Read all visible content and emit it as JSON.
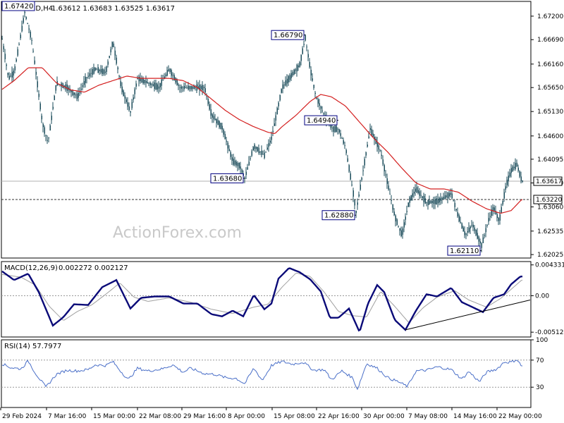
{
  "header": {
    "symbol": "EURAUD,H4",
    "ohlc": "1.63612 1.63683 1.63525 1.63617"
  },
  "watermark": "ActionForex.com",
  "chart_data": [
    {
      "type": "line",
      "name": "price",
      "ylim": [
        1.6195,
        1.6752
      ],
      "yticks": [
        "1.67200",
        "1.66690",
        "1.66160",
        "1.65650",
        "1.65130",
        "1.64600",
        "1.64095",
        "1.63580",
        "1.63060",
        "1.62535",
        "1.62025"
      ],
      "ytick_values": [
        1.672,
        1.6669,
        1.6616,
        1.6565,
        1.6513,
        1.646,
        1.64095,
        1.6358,
        1.6306,
        1.62535,
        1.62025
      ],
      "current_label": "1.63617",
      "current_value": 1.63617,
      "level_label": "1.63220",
      "level_value": 1.6322,
      "xticks": [
        "29 Feb 2024",
        "7 Mar 16:00",
        "15 Mar 00:00",
        "22 Mar 08:00",
        "29 Mar 16:00",
        "8 Apr 00:00",
        "15 Apr 08:00",
        "22 Apr 16:00",
        "30 Apr 00:00",
        "7 May 08:00",
        "14 May 16:00",
        "22 May 00:00"
      ],
      "annotations": [
        {
          "text": "1.67420",
          "value": 1.6742,
          "bar": 30
        },
        {
          "text": "1.66790",
          "value": 1.6679,
          "bar": 433
        },
        {
          "text": "1.63680",
          "value": 1.6368,
          "bar": 347
        },
        {
          "text": "1.64940",
          "value": 1.6494,
          "bar": 480
        },
        {
          "text": "1.62880",
          "value": 1.6288,
          "bar": 505
        },
        {
          "text": "1.62110",
          "value": 1.6211,
          "bar": 683
        }
      ],
      "price_anchors": [
        [
          2,
          1.668
        ],
        [
          12,
          1.6585
        ],
        [
          20,
          1.6598
        ],
        [
          35,
          1.6728
        ],
        [
          45,
          1.6668
        ],
        [
          60,
          1.6488
        ],
        [
          68,
          1.6445
        ],
        [
          80,
          1.6575
        ],
        [
          95,
          1.6565
        ],
        [
          110,
          1.6545
        ],
        [
          122,
          1.6585
        ],
        [
          135,
          1.6605
        ],
        [
          150,
          1.6598
        ],
        [
          160,
          1.6665
        ],
        [
          172,
          1.6565
        ],
        [
          185,
          1.6512
        ],
        [
          195,
          1.6585
        ],
        [
          210,
          1.6575
        ],
        [
          225,
          1.6565
        ],
        [
          240,
          1.6605
        ],
        [
          255,
          1.6565
        ],
        [
          270,
          1.6565
        ],
        [
          290,
          1.6565
        ],
        [
          300,
          1.6505
        ],
        [
          315,
          1.6478
        ],
        [
          330,
          1.6405
        ],
        [
          340,
          1.6395
        ],
        [
          347,
          1.6368
        ],
        [
          360,
          1.6438
        ],
        [
          375,
          1.6418
        ],
        [
          385,
          1.6455
        ],
        [
          400,
          1.6565
        ],
        [
          415,
          1.6595
        ],
        [
          425,
          1.6615
        ],
        [
          433,
          1.6673
        ],
        [
          440,
          1.6605
        ],
        [
          448,
          1.6545
        ],
        [
          460,
          1.6505
        ],
        [
          472,
          1.6475
        ],
        [
          480,
          1.6475
        ],
        [
          490,
          1.6435
        ],
        [
          500,
          1.6345
        ],
        [
          505,
          1.6295
        ],
        [
          515,
          1.6385
        ],
        [
          525,
          1.6475
        ],
        [
          540,
          1.6425
        ],
        [
          550,
          1.6355
        ],
        [
          560,
          1.6285
        ],
        [
          570,
          1.6245
        ],
        [
          580,
          1.6318
        ],
        [
          590,
          1.6345
        ],
        [
          605,
          1.6315
        ],
        [
          620,
          1.6318
        ],
        [
          640,
          1.6335
        ],
        [
          650,
          1.6285
        ],
        [
          660,
          1.6245
        ],
        [
          670,
          1.6268
        ],
        [
          683,
          1.6222
        ],
        [
          693,
          1.6278
        ],
        [
          700,
          1.6305
        ],
        [
          708,
          1.6275
        ],
        [
          718,
          1.6355
        ],
        [
          725,
          1.6385
        ],
        [
          733,
          1.6398
        ],
        [
          740,
          1.6362
        ]
      ],
      "ma_anchors": [
        [
          2,
          1.656
        ],
        [
          20,
          1.658
        ],
        [
          40,
          1.6608
        ],
        [
          60,
          1.6608
        ],
        [
          80,
          1.6575
        ],
        [
          100,
          1.656
        ],
        [
          120,
          1.6555
        ],
        [
          140,
          1.657
        ],
        [
          160,
          1.658
        ],
        [
          180,
          1.659
        ],
        [
          200,
          1.6585
        ],
        [
          220,
          1.6585
        ],
        [
          240,
          1.6585
        ],
        [
          260,
          1.658
        ],
        [
          280,
          1.6565
        ],
        [
          300,
          1.654
        ],
        [
          320,
          1.6515
        ],
        [
          340,
          1.6495
        ],
        [
          360,
          1.648
        ],
        [
          380,
          1.6468
        ],
        [
          390,
          1.6465
        ],
        [
          400,
          1.648
        ],
        [
          420,
          1.6505
        ],
        [
          440,
          1.6535
        ],
        [
          455,
          1.655
        ],
        [
          470,
          1.6545
        ],
        [
          490,
          1.6525
        ],
        [
          510,
          1.649
        ],
        [
          530,
          1.6455
        ],
        [
          550,
          1.6425
        ],
        [
          570,
          1.639
        ],
        [
          590,
          1.6358
        ],
        [
          610,
          1.6345
        ],
        [
          630,
          1.6345
        ],
        [
          650,
          1.6338
        ],
        [
          670,
          1.6318
        ],
        [
          690,
          1.6302
        ],
        [
          710,
          1.6292
        ],
        [
          725,
          1.6298
        ],
        [
          740,
          1.6322
        ]
      ]
    },
    {
      "type": "line",
      "name": "MACD(12,26,9)",
      "header_label": "MACD(12,26,9)",
      "header_values": "0.002272 0.002127",
      "ylim": [
        -0.0058,
        0.0048
      ],
      "yticks": [
        "0.004331",
        "0.00",
        "-0.005122"
      ],
      "ytick_values": [
        0.004331,
        0.0,
        -0.005122
      ],
      "macd_anchors": [
        [
          2,
          0.0035
        ],
        [
          20,
          0.0022
        ],
        [
          40,
          0.0031
        ],
        [
          55,
          0.0005
        ],
        [
          75,
          -0.0042
        ],
        [
          90,
          -0.003
        ],
        [
          105,
          -0.0012
        ],
        [
          125,
          -0.0013
        ],
        [
          145,
          0.0012
        ],
        [
          165,
          0.0022
        ],
        [
          185,
          -0.0018
        ],
        [
          200,
          -0.0003
        ],
        [
          220,
          -0.0001
        ],
        [
          240,
          -0.0001
        ],
        [
          260,
          -0.0011
        ],
        [
          280,
          -0.0011
        ],
        [
          300,
          -0.0026
        ],
        [
          315,
          -0.0029
        ],
        [
          330,
          -0.0021
        ],
        [
          345,
          -0.0029
        ],
        [
          360,
          0.0001
        ],
        [
          375,
          -0.0019
        ],
        [
          385,
          -0.0011
        ],
        [
          395,
          0.0024
        ],
        [
          410,
          0.0039
        ],
        [
          425,
          0.0033
        ],
        [
          440,
          0.0023
        ],
        [
          455,
          0.0006
        ],
        [
          468,
          -0.0031
        ],
        [
          480,
          -0.0031
        ],
        [
          495,
          -0.0018
        ],
        [
          510,
          -0.0051
        ],
        [
          522,
          -0.0011
        ],
        [
          535,
          0.0015
        ],
        [
          545,
          0.0005
        ],
        [
          560,
          -0.0034
        ],
        [
          575,
          -0.0048
        ],
        [
          590,
          -0.0021
        ],
        [
          605,
          0.0002
        ],
        [
          620,
          -0.0001
        ],
        [
          640,
          0.0011
        ],
        [
          655,
          -0.0009
        ],
        [
          670,
          -0.0016
        ],
        [
          685,
          -0.0023
        ],
        [
          700,
          -0.0003
        ],
        [
          715,
          0.0002
        ],
        [
          725,
          0.0016
        ],
        [
          738,
          0.0027
        ]
      ],
      "signal_anchors": [
        [
          2,
          0.003
        ],
        [
          30,
          0.0026
        ],
        [
          50,
          0.0015
        ],
        [
          70,
          -0.0015
        ],
        [
          90,
          -0.0035
        ],
        [
          110,
          -0.0022
        ],
        [
          130,
          -0.0013
        ],
        [
          150,
          0.0002
        ],
        [
          170,
          0.0018
        ],
        [
          190,
          -0.0002
        ],
        [
          210,
          -0.0008
        ],
        [
          240,
          -0.0003
        ],
        [
          270,
          -0.0009
        ],
        [
          300,
          -0.0019
        ],
        [
          330,
          -0.0025
        ],
        [
          360,
          -0.0016
        ],
        [
          380,
          -0.0012
        ],
        [
          400,
          0.0012
        ],
        [
          420,
          0.0032
        ],
        [
          440,
          0.0027
        ],
        [
          460,
          0.0005
        ],
        [
          480,
          -0.0022
        ],
        [
          500,
          -0.0028
        ],
        [
          520,
          -0.003
        ],
        [
          540,
          0.0006
        ],
        [
          560,
          -0.0015
        ],
        [
          580,
          -0.0038
        ],
        [
          600,
          -0.0017
        ],
        [
          620,
          -0.0002
        ],
        [
          645,
          0.0007
        ],
        [
          665,
          -0.0006
        ],
        [
          690,
          -0.0016
        ],
        [
          710,
          -0.0004
        ],
        [
          725,
          0.0009
        ],
        [
          740,
          0.0022
        ]
      ],
      "trendline": [
        [
          575,
          -0.0048
        ],
        [
          752,
          -0.0006
        ]
      ]
    },
    {
      "type": "line",
      "name": "RSI(14)",
      "header_label": "RSI(14)",
      "header_values": "57.7977",
      "ylim": [
        0,
        100
      ],
      "yticks": [
        "100",
        "70",
        "30",
        "0"
      ],
      "ytick_values": [
        100,
        70,
        30,
        0
      ],
      "rsi_anchors": [
        [
          2,
          65
        ],
        [
          15,
          59
        ],
        [
          30,
          57
        ],
        [
          40,
          69
        ],
        [
          50,
          51
        ],
        [
          65,
          30
        ],
        [
          80,
          49
        ],
        [
          95,
          55
        ],
        [
          110,
          54
        ],
        [
          125,
          56
        ],
        [
          135,
          63
        ],
        [
          150,
          62
        ],
        [
          160,
          68
        ],
        [
          170,
          55
        ],
        [
          182,
          41
        ],
        [
          195,
          58
        ],
        [
          210,
          54
        ],
        [
          230,
          57
        ],
        [
          245,
          63
        ],
        [
          260,
          52
        ],
        [
          270,
          58
        ],
        [
          290,
          50
        ],
        [
          305,
          49
        ],
        [
          320,
          44
        ],
        [
          335,
          43
        ],
        [
          347,
          35
        ],
        [
          360,
          58
        ],
        [
          372,
          40
        ],
        [
          385,
          62
        ],
        [
          400,
          68
        ],
        [
          415,
          64
        ],
        [
          430,
          67
        ],
        [
          445,
          55
        ],
        [
          460,
          56
        ],
        [
          470,
          41
        ],
        [
          485,
          54
        ],
        [
          500,
          44
        ],
        [
          507,
          27
        ],
        [
          520,
          65
        ],
        [
          535,
          58
        ],
        [
          550,
          44
        ],
        [
          565,
          38
        ],
        [
          578,
          31
        ],
        [
          590,
          54
        ],
        [
          605,
          55
        ],
        [
          620,
          60
        ],
        [
          640,
          56
        ],
        [
          655,
          42
        ],
        [
          665,
          53
        ],
        [
          680,
          38
        ],
        [
          690,
          52
        ],
        [
          705,
          57
        ],
        [
          715,
          67
        ],
        [
          725,
          67
        ],
        [
          733,
          71
        ],
        [
          740,
          61
        ]
      ]
    }
  ],
  "colors": {
    "candle": "#1a4b5a",
    "ma": "#d42020",
    "macd": "#0a0a78",
    "signal": "#a0a0a0",
    "rsi": "#4a6fc8",
    "label_border": "#000080"
  }
}
